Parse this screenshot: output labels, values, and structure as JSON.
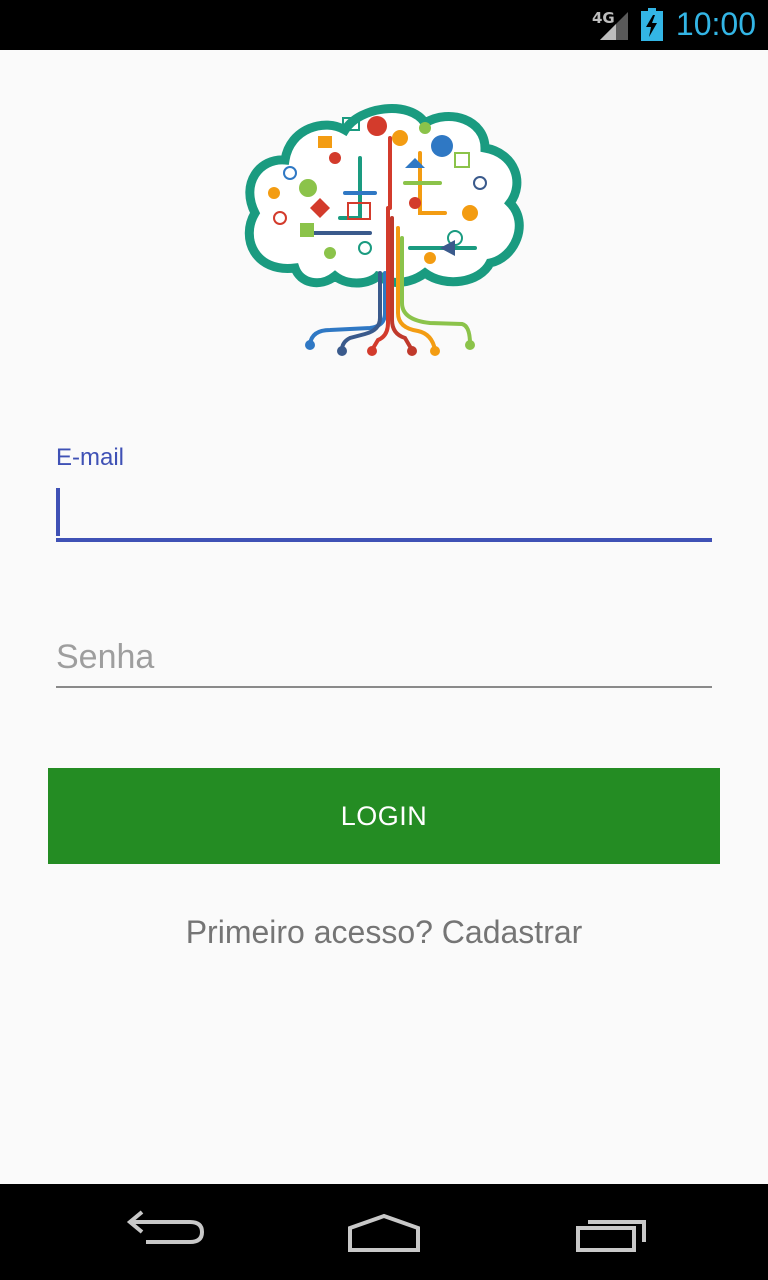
{
  "status_bar": {
    "network": "4G",
    "time": "10:00",
    "icons": [
      "signal-icon",
      "battery-charging-icon"
    ]
  },
  "logo": {
    "icon": "tree-of-icons-logo"
  },
  "login_form": {
    "email_label": "E-mail",
    "email_value": "",
    "password_placeholder": "Senha",
    "password_value": "",
    "login_button_label": "LOGIN",
    "signup_link": "Primeiro acesso? Cadastrar"
  },
  "nav_bar": {
    "icons": [
      "back-icon",
      "home-icon",
      "recent-apps-icon"
    ]
  },
  "colors": {
    "accent": "#3f51b5",
    "button": "#248c23",
    "clock": "#33b5e5",
    "logo_teal": "#1a9b80"
  }
}
